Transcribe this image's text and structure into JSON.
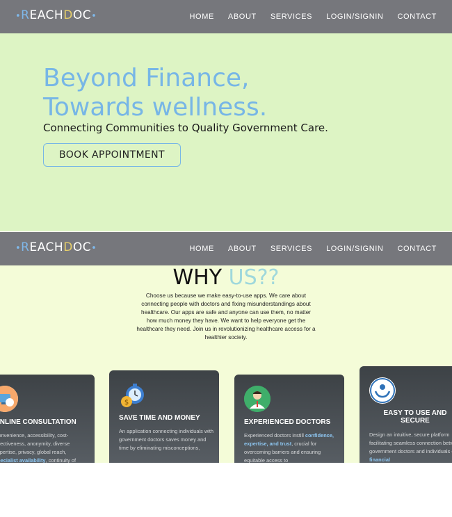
{
  "brand": {
    "prefix_dot": "•",
    "r": "R",
    "each": "EACH",
    "d": "D",
    "oc": "OC",
    "suffix_dot": "•"
  },
  "nav": {
    "items": [
      "HOME",
      "ABOUT",
      "SERVICES",
      "LOGIN/SIGNIN",
      "CONTACT"
    ]
  },
  "hero": {
    "title_line1": "Beyond Finance,",
    "title_line2": "Towards wellness.",
    "subtitle": "Connecting Communities to Quality Government Care.",
    "cta": "BOOK APPOINTMENT"
  },
  "why": {
    "title_main": "WHY ",
    "title_accent": "US??",
    "body": "Choose us because we make easy-to-use apps. We care about connecting people with doctors and fixing misunderstandings about healthcare. Our apps are safe and anyone can use them, no matter how much money they have. We want to help everyone get the healthcare they need. Join us in revolutionizing healthcare access for a healthier society."
  },
  "cards": [
    {
      "title": "ONLINE CONSULTATION",
      "body_pre": "Convenience, accessibility, cost-effectiveness, anonymity, diverse expertise, privacy, global reach, ",
      "body_hl": "specialist availability",
      "body_post": ", continuity of",
      "icon": "consultation-icon"
    },
    {
      "title": "SAVE TIME AND MONEY",
      "body_pre": "An application connecting individuals with government doctors saves money and time by eliminating misconceptions,",
      "body_hl": "",
      "body_post": "",
      "icon": "stopwatch-coin-icon"
    },
    {
      "title": "EXPERIENCED DOCTORS",
      "body_pre": "Experienced doctors instill ",
      "body_hl": "confidence, expertise, and trust",
      "body_post": ", crucial for overcoming barriers and ensuring equitable access to",
      "icon": "doctor-icon"
    },
    {
      "title_line1": "EASY TO USE AND",
      "title_line2": "SECURE",
      "body_pre": "Design an intuitive, secure platform facilitating seamless connection between government doctors and individuals of all ",
      "body_hl": "financial",
      "body_post": "",
      "icon": "secure-hands-icon"
    }
  ],
  "colors": {
    "navbar": "#76777c",
    "hero_bg": "#ddf4c4",
    "why_bg": "#f4fcd8",
    "accent_blue": "#77b6e6",
    "accent_teal": "#9fd8dc"
  }
}
